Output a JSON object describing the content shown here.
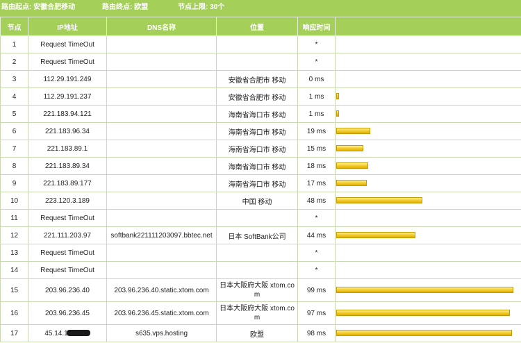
{
  "header": {
    "route_start": "路由起点: 安徽合肥移动",
    "route_end": "路由终点: 欧盟",
    "hop_limit": "节点上限: 30个"
  },
  "columns": [
    "节点",
    "IP地址",
    "DNS名称",
    "位置",
    "响应时间",
    ""
  ],
  "rows": [
    {
      "hop": "1",
      "ip": "Request TimeOut",
      "dns": "",
      "loc": "",
      "time": "*",
      "bar_ms": 0
    },
    {
      "hop": "2",
      "ip": "Request TimeOut",
      "dns": "",
      "loc": "",
      "time": "*",
      "bar_ms": 0
    },
    {
      "hop": "3",
      "ip": "112.29.191.249",
      "dns": "",
      "loc": "安徽省合肥市 移动",
      "time": "0 ms",
      "bar_ms": 0
    },
    {
      "hop": "4",
      "ip": "112.29.191.237",
      "dns": "",
      "loc": "安徽省合肥市 移动",
      "time": "1 ms",
      "bar_ms": 1
    },
    {
      "hop": "5",
      "ip": "221.183.94.121",
      "dns": "",
      "loc": "海南省海口市 移动",
      "time": "1 ms",
      "bar_ms": 1
    },
    {
      "hop": "6",
      "ip": "221.183.96.34",
      "dns": "",
      "loc": "海南省海口市 移动",
      "time": "19 ms",
      "bar_ms": 19
    },
    {
      "hop": "7",
      "ip": "221.183.89.1",
      "dns": "",
      "loc": "海南省海口市 移动",
      "time": "15 ms",
      "bar_ms": 15
    },
    {
      "hop": "8",
      "ip": "221.183.89.34",
      "dns": "",
      "loc": "海南省海口市 移动",
      "time": "18 ms",
      "bar_ms": 18
    },
    {
      "hop": "9",
      "ip": "221.183.89.177",
      "dns": "",
      "loc": "海南省海口市 移动",
      "time": "17 ms",
      "bar_ms": 17
    },
    {
      "hop": "10",
      "ip": "223.120.3.189",
      "dns": "",
      "loc": "中国 移动",
      "time": "48 ms",
      "bar_ms": 48
    },
    {
      "hop": "11",
      "ip": "Request TimeOut",
      "dns": "",
      "loc": "",
      "time": "*",
      "bar_ms": 0
    },
    {
      "hop": "12",
      "ip": "221.111.203.97",
      "dns": "softbank221111203097.bbtec.net",
      "loc": "日本 SoftBank公司",
      "time": "44 ms",
      "bar_ms": 44
    },
    {
      "hop": "13",
      "ip": "Request TimeOut",
      "dns": "",
      "loc": "",
      "time": "*",
      "bar_ms": 0
    },
    {
      "hop": "14",
      "ip": "Request TimeOut",
      "dns": "",
      "loc": "",
      "time": "*",
      "bar_ms": 0
    },
    {
      "hop": "15",
      "ip": "203.96.236.40",
      "dns": "203.96.236.40.static.xtom.com",
      "loc": "日本大阪府大阪 xtom.com",
      "time": "99 ms",
      "bar_ms": 99,
      "tall": true
    },
    {
      "hop": "16",
      "ip": "203.96.236.45",
      "dns": "203.96.236.45.static.xtom.com",
      "loc": "日本大阪府大阪 xtom.com",
      "time": "97 ms",
      "bar_ms": 97,
      "tall": true
    },
    {
      "hop": "17",
      "ip": "45.14.1",
      "dns": "s635.vps.hosting",
      "loc": "欧盟",
      "time": "98 ms",
      "bar_ms": 98,
      "masked": true
    }
  ]
}
